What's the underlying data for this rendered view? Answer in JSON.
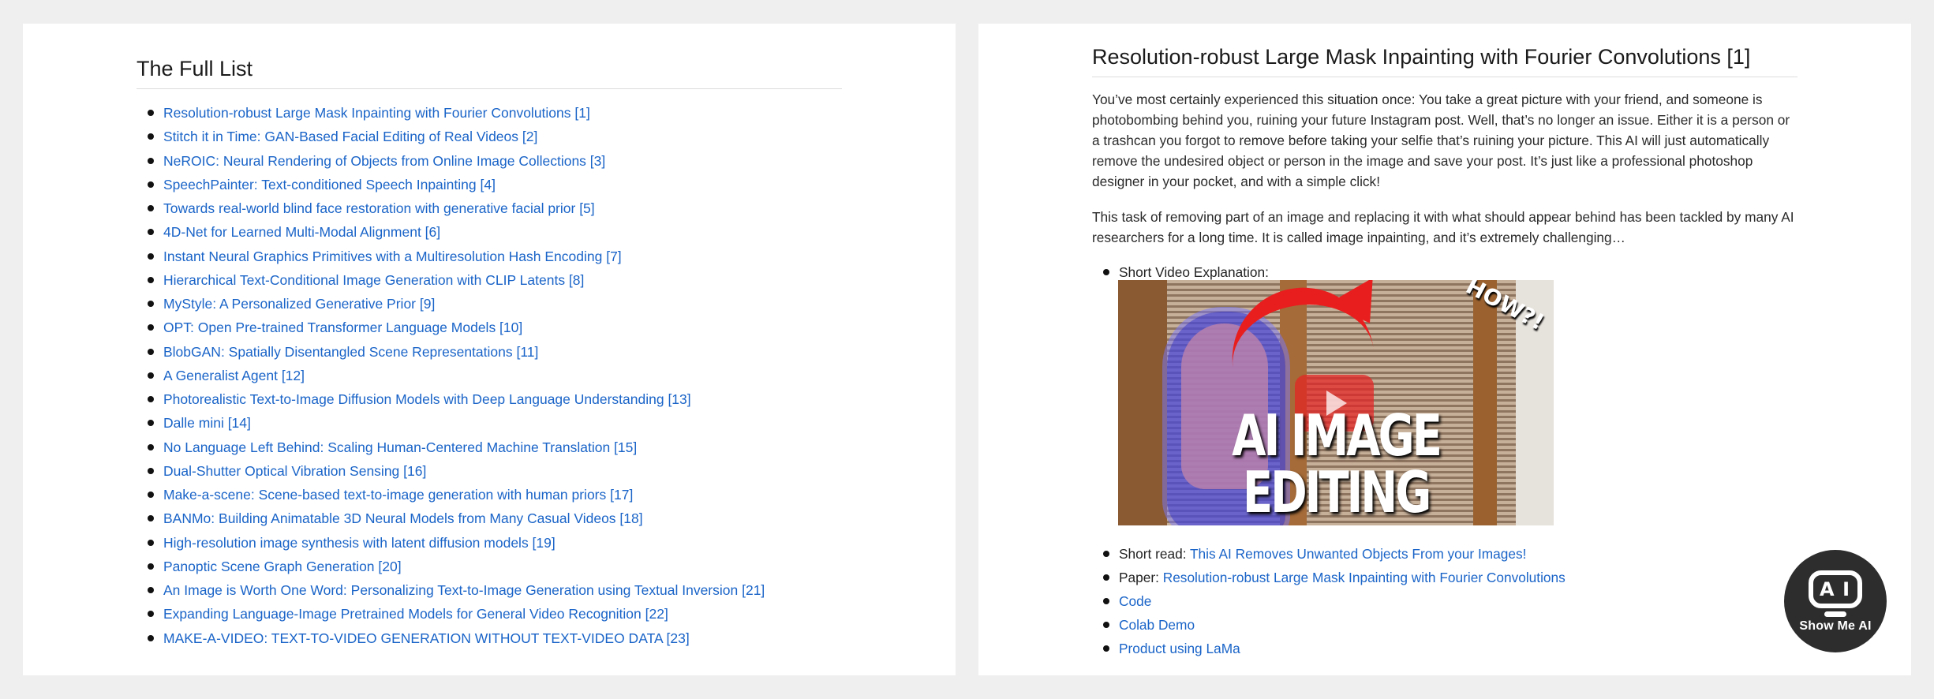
{
  "left": {
    "heading": "The Full List",
    "items": [
      "Resolution-robust Large Mask Inpainting with Fourier Convolutions [1]",
      "Stitch it in Time: GAN-Based Facial Editing of Real Videos [2]",
      "NeROIC: Neural Rendering of Objects from Online Image Collections [3]",
      "SpeechPainter: Text-conditioned Speech Inpainting [4]",
      "Towards real-world blind face restoration with generative facial prior [5]",
      "4D-Net for Learned Multi-Modal Alignment [6]",
      "Instant Neural Graphics Primitives with a Multiresolution Hash Encoding [7]",
      "Hierarchical Text-Conditional Image Generation with CLIP Latents [8]",
      "MyStyle: A Personalized Generative Prior [9]",
      "OPT: Open Pre-trained Transformer Language Models [10]",
      "BlobGAN: Spatially Disentangled Scene Representations [11]",
      "A Generalist Agent [12]",
      "Photorealistic Text-to-Image Diffusion Models with Deep Language Understanding [13]",
      "Dalle mini [14]",
      "No Language Left Behind: Scaling Human-Centered Machine Translation [15]",
      "Dual-Shutter Optical Vibration Sensing [16]",
      "Make-a-scene: Scene-based text-to-image generation with human priors [17]",
      "BANMo: Building Animatable 3D Neural Models from Many Casual Videos [18]",
      "High-resolution image synthesis with latent diffusion models [19]",
      "Panoptic Scene Graph Generation [20]",
      "An Image is Worth One Word: Personalizing Text-to-Image Generation using Textual Inversion [21]",
      "Expanding Language-Image Pretrained Models for General Video Recognition [22]",
      "MAKE-A-VIDEO: TEXT-TO-VIDEO GENERATION WITHOUT TEXT-VIDEO DATA [23]"
    ]
  },
  "right": {
    "heading": "Resolution-robust Large Mask Inpainting with Fourier Convolutions [1]",
    "paragraph1": "You’ve most certainly experienced this situation once: You take a great picture with your friend, and someone is photobombing behind you, ruining your future Instagram post. Well, that’s no longer an issue. Either it is a person or a trashcan you forgot to remove before taking your selfie that’s ruining your picture. This AI will just automatically remove the undesired object or person in the image and save your post. It’s just like a professional photoshop designer in your pocket, and with a simple click!",
    "paragraph2": "This task of removing part of an image and replacing it with what should appear behind has been tackled by many AI researchers for a long time. It is called image inpainting, and it’s extremely challenging…",
    "video_label": "Short Video Explanation:",
    "thumbnail": {
      "caption": "AI IMAGE EDITING",
      "corner_text": "HOW?!"
    },
    "short_read_label": "Short read: ",
    "short_read_link": "This AI Removes Unwanted Objects From your Images!",
    "paper_label": "Paper: ",
    "paper_link": "Resolution-robust Large Mask Inpainting with Fourier Convolutions",
    "code_link": "Code",
    "colab_link": "Colab Demo",
    "product_link": "Product using LaMa"
  },
  "logo": {
    "text": "Show Me AI",
    "face_left": "A",
    "face_right": "I"
  },
  "colors": {
    "link": "#1a64c8",
    "background": "#efefef",
    "panel": "#ffffff"
  }
}
